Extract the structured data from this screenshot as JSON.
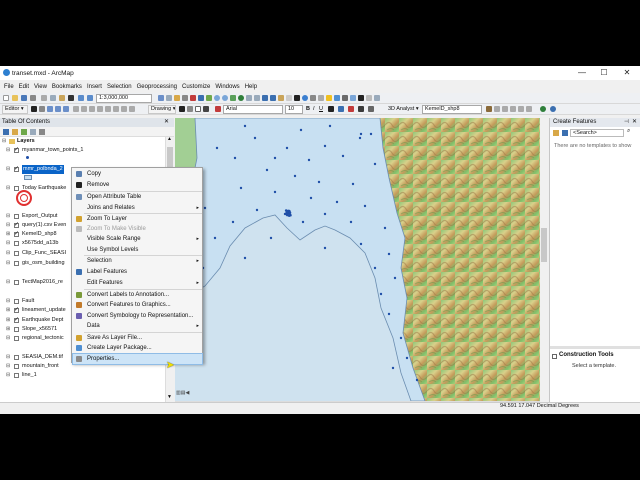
{
  "window": {
    "title": "transet.mxd - ArcMap",
    "minimize": "—",
    "maximize": "☐",
    "close": "✕"
  },
  "menubar": [
    "File",
    "Edit",
    "View",
    "Bookmarks",
    "Insert",
    "Selection",
    "Geoprocessing",
    "Customize",
    "Windows",
    "Help"
  ],
  "toolbar": {
    "scale": "1:3,000,000",
    "editor_label": "Editor ▾",
    "drawing_label": "Drawing ▾",
    "font": "Arial",
    "font_size": "10",
    "analyst_label": "3D Analyst ▾",
    "analyst_layer": "KemelD_shp8"
  },
  "toc": {
    "title": "Table Of Contents",
    "root": "Layers",
    "layers": [
      {
        "label": "myanmar_town_points_1",
        "checked": true,
        "expanded": true
      },
      {
        "label": "mmr_polbnda_2",
        "checked": true,
        "expanded": true,
        "selected": true
      },
      {
        "label": "Today Earthquake",
        "checked": false,
        "expanded": true
      },
      {
        "label": "Export_Output",
        "checked": false,
        "expanded": true
      },
      {
        "label": "query(1).csv Even",
        "checked": true,
        "expanded": true
      },
      {
        "label": "KemelD_shp8",
        "checked": true,
        "expanded": false
      },
      {
        "label": "x5675dd_a13b",
        "checked": false,
        "expanded": true
      },
      {
        "label": "Clip_Func_SEASI",
        "checked": false,
        "expanded": true
      },
      {
        "label": "gis_osm_building",
        "checked": false,
        "expanded": true
      },
      {
        "label": "TectMap2016_re",
        "checked": false,
        "expanded": true
      },
      {
        "label": "Fault",
        "checked": false,
        "expanded": true
      },
      {
        "label": "lineament_update",
        "checked": true,
        "expanded": false
      },
      {
        "label": "Earthquake Dept",
        "checked": true,
        "expanded": false
      },
      {
        "label": "Slope_x56571",
        "checked": false,
        "expanded": false
      },
      {
        "label": "regional_tectonic",
        "checked": false,
        "expanded": true
      },
      {
        "label": "SEASIA_DEM.tif",
        "checked": false,
        "expanded": true
      },
      {
        "label": "mountain_front",
        "checked": false,
        "expanded": true
      },
      {
        "label": "line_1",
        "checked": false,
        "expanded": true
      }
    ]
  },
  "context_menu": {
    "items": [
      {
        "label": "Copy",
        "icon": "copy-icon",
        "color": "#5a7fb0"
      },
      {
        "label": "Remove",
        "icon": "remove-icon",
        "color": "#222222"
      },
      {
        "label": "Open Attribute Table",
        "icon": "table-icon",
        "color": "#6f8fb8"
      },
      {
        "label": "Joins and Relates",
        "icon": "",
        "submenu": true
      },
      {
        "label": "Zoom To Layer",
        "icon": "zoom-layer-icon",
        "color": "#d2a230"
      },
      {
        "label": "Zoom To Make Visible",
        "icon": "zoom-visible-icon",
        "color": "#bbbbbb",
        "disabled": true
      },
      {
        "label": "Visible Scale Range",
        "icon": "",
        "submenu": true
      },
      {
        "label": "Use Symbol Levels",
        "icon": ""
      },
      {
        "label": "Selection",
        "icon": "",
        "submenu": true
      },
      {
        "label": "Label Features",
        "icon": "label-icon",
        "color": "#3b6fb0"
      },
      {
        "label": "Edit Features",
        "icon": "",
        "submenu": true
      },
      {
        "label": "Convert Labels to Annotation...",
        "icon": "annotation-icon",
        "color": "#7a9a3a"
      },
      {
        "label": "Convert Features to Graphics...",
        "icon": "graphics-icon",
        "color": "#c27a2a"
      },
      {
        "label": "Convert Symbology to Representation...",
        "icon": "representation-icon",
        "color": "#6b5fb0"
      },
      {
        "label": "Data",
        "icon": "",
        "submenu": true
      },
      {
        "label": "Save As Layer File...",
        "icon": "layer-file-icon",
        "color": "#d2a230"
      },
      {
        "label": "Create Layer Package...",
        "icon": "package-icon",
        "color": "#4f8fd2"
      },
      {
        "label": "Properties...",
        "icon": "properties-icon",
        "color": "#8a8a8a",
        "highlighted": true
      }
    ]
  },
  "create_features": {
    "title": "Create Features",
    "search_placeholder": "<Search>",
    "empty_message": "There are no templates to show"
  },
  "construction_tools": {
    "title": "Construction Tools",
    "message": "Select a template."
  },
  "status": {
    "coordinates": "94.591  17.047 Decimal Degrees"
  },
  "colors": {
    "sea": "#cfe2ef",
    "myanmar_fill": "#c8e0f2",
    "border": "#6b8db0",
    "points": "#1f4fa8",
    "dem_green": "#7fbf6a",
    "dem_yellow": "#e6d48a",
    "dem_brown": "#b8864e",
    "selection": "#0a64c8"
  }
}
